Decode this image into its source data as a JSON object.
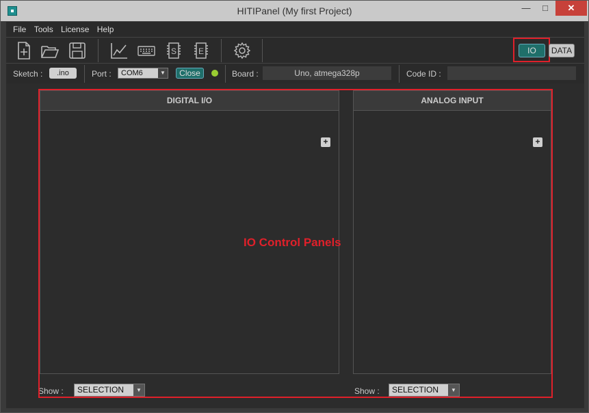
{
  "window": {
    "title": "HITIPanel      (My first Project)",
    "min_glyph": "—",
    "max_glyph": "□",
    "close_glyph": "✕"
  },
  "menubar": {
    "items": [
      "File",
      "Tools",
      "License",
      "Help"
    ]
  },
  "toolbar": {
    "icons": [
      "new-file-icon",
      "open-folder-icon",
      "save-icon",
      "chart-icon",
      "keyboard-icon",
      "s-chip-icon",
      "e-chip-icon",
      "settings-gear-icon"
    ],
    "io_label": "IO",
    "data_label": "DATA"
  },
  "infobar": {
    "sketch_label": "Sketch :",
    "ino_label": ".ino",
    "port_label": "Port :",
    "port_value": "COM6",
    "close_label": "Close",
    "board_label": "Board :",
    "board_value": "Uno, atmega328p",
    "codeid_label": "Code ID :",
    "codeid_value": "",
    "led_color": "#9acd32"
  },
  "panels": {
    "digital": {
      "title": "DIGITAL  I/O",
      "add_label": "+",
      "show_label": "Show :",
      "show_value": "SELECTION"
    },
    "analog": {
      "title": "ANALOG  INPUT",
      "add_label": "+",
      "show_label": "Show :",
      "show_value": "SELECTION"
    }
  },
  "annotations": {
    "panels_caption": "IO Control Panels"
  },
  "colors": {
    "accent_teal": "#1f6f6a",
    "highlight_red": "#e0202a",
    "background_dark": "#2c2c2c"
  }
}
